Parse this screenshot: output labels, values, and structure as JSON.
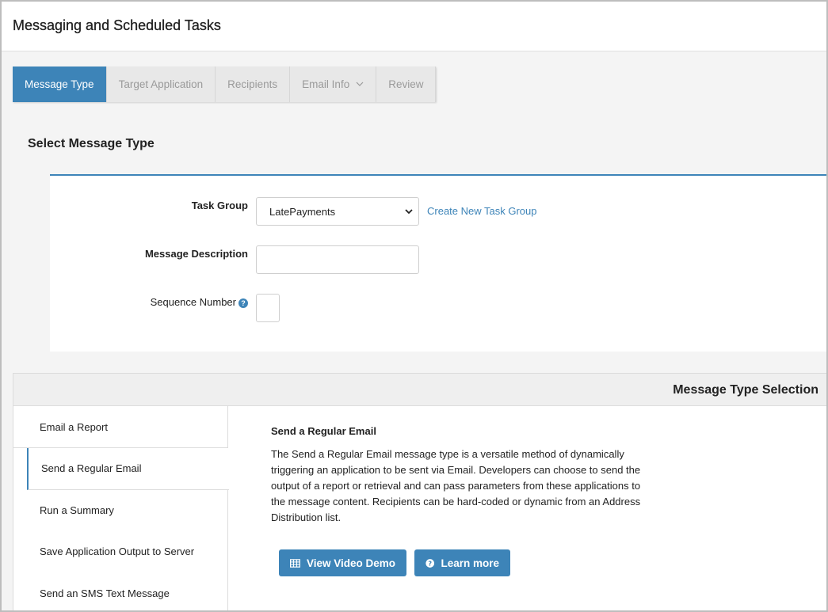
{
  "page": {
    "title": "Messaging and Scheduled Tasks"
  },
  "tabs": [
    {
      "label": "Message Type",
      "active": true
    },
    {
      "label": "Target Application",
      "active": false
    },
    {
      "label": "Recipients",
      "active": false
    },
    {
      "label": "Email Info",
      "active": false,
      "has_dropdown": true
    },
    {
      "label": "Review",
      "active": false
    }
  ],
  "section": {
    "title": "Select Message Type"
  },
  "form": {
    "task_group_label": "Task Group",
    "task_group_value": "LatePayments",
    "create_task_group_link": "Create New Task Group",
    "message_description_label": "Message Description",
    "message_description_value": "",
    "sequence_number_label": "Sequence Number",
    "sequence_number_value": "",
    "help_icon": "question-circle-icon"
  },
  "message_type_selection": {
    "header": "Message Type Selection",
    "items": [
      {
        "label": "Email a Report"
      },
      {
        "label": "Send a Regular Email",
        "active": true
      },
      {
        "label": "Run a Summary"
      },
      {
        "label": "Save Application Output to Server"
      },
      {
        "label": "Send an SMS Text Message"
      }
    ],
    "detail": {
      "title": "Send a Regular Email",
      "description": "The Send a Regular Email message type is a versatile method of dynamically triggering an application to be sent via Email. Developers can choose to send the output of a report or retrieval and can pass parameters from these applications to the message content. Recipients can be hard-coded or dynamic from an Address Distribution list.",
      "video_button": "View Video Demo",
      "learn_button": "Learn more"
    }
  },
  "colors": {
    "accent": "#3d84b8",
    "background": "#f4f4f4",
    "tab_inactive_text": "#9a9a9a"
  }
}
